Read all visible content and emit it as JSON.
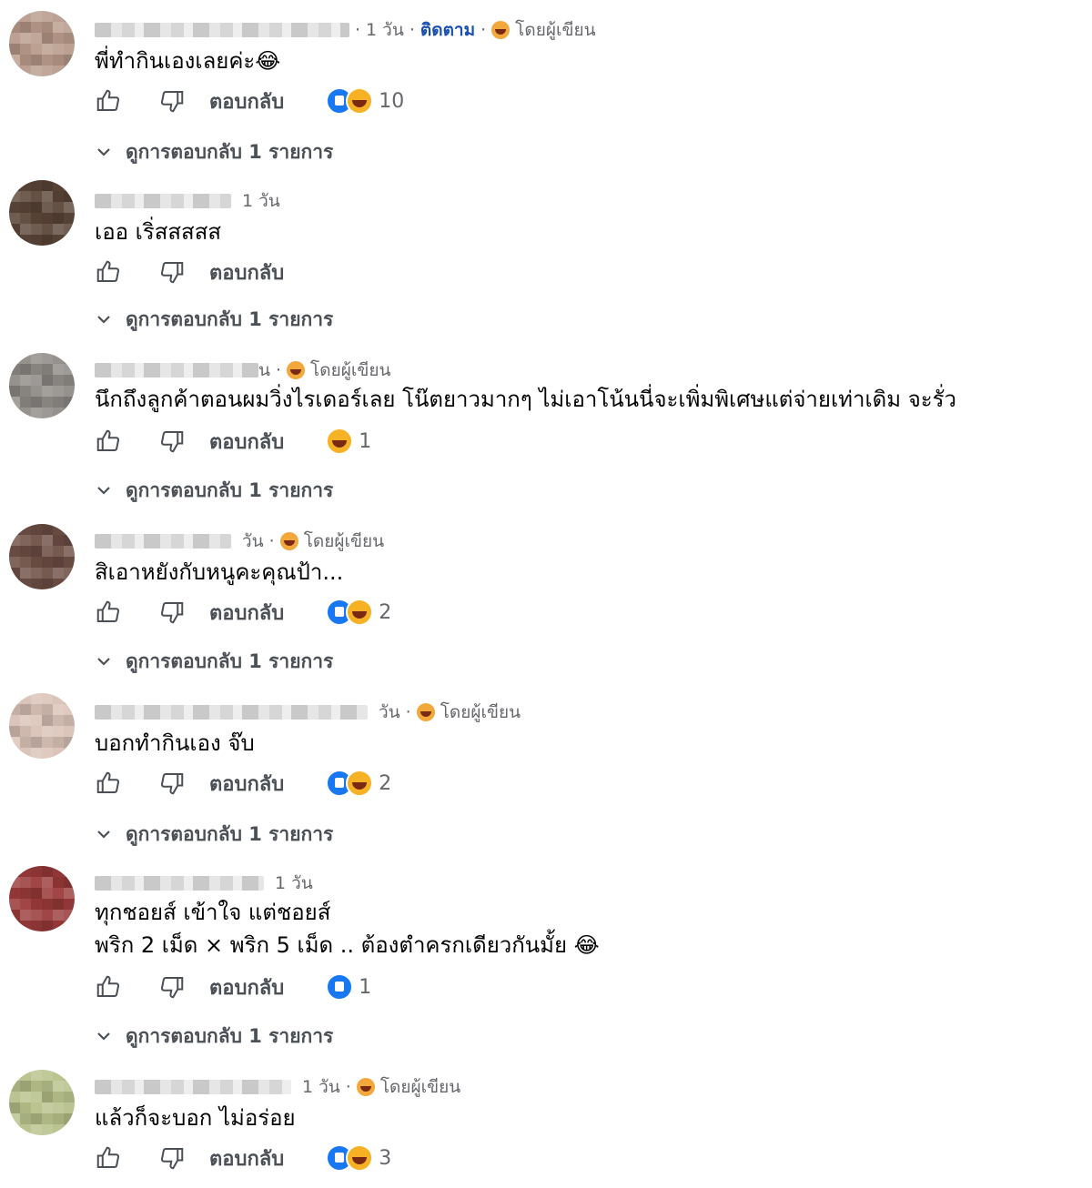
{
  "labels": {
    "reply": "ตอบกลับ",
    "view_replies": "ดูการตอบกลับ 1 รายการ",
    "by_author": "โดยผู้เขียน",
    "follow": "ติดตาม"
  },
  "comments": [
    {
      "time": "1 วัน",
      "text1": "พี่ทำกินเองเลยค่ะ😂",
      "text2": "",
      "count": "10"
    },
    {
      "time": "1 วัน",
      "text1": "เออ เริ่สสสสส",
      "text2": "",
      "count": ""
    },
    {
      "time": "น",
      "text1": "นึกถึงลูกค้าตอนผมวิ่งไรเดอร์เลย โน๊ตยาวมากๆ ไม่เอาโน้นนี่จะเพิ่มพิเศษแต่จ่ายเท่าเดิม จะรั่ว",
      "text2": "",
      "count": "1"
    },
    {
      "time": "วัน",
      "text1": "สิเอาหยังกับหนูคะคุณป้า...",
      "text2": "",
      "count": "2"
    },
    {
      "time": "วัน",
      "text1": "บอกทำกินเอง จ๊บ",
      "text2": "",
      "count": "2"
    },
    {
      "time": "1 วัน",
      "text1": "ทุกชอยส์ เข้าใจ แต่ชอยส์",
      "text2": "พริก 2 เม็ด × พริก 5 เม็ด .. ต้องตำครกเดียวกันมั้ย 😂",
      "count": "1"
    },
    {
      "time": "1 วัน",
      "text1": "แล้วก็จะบอก ไม่อร่อย",
      "text2": "",
      "count": "3"
    }
  ]
}
